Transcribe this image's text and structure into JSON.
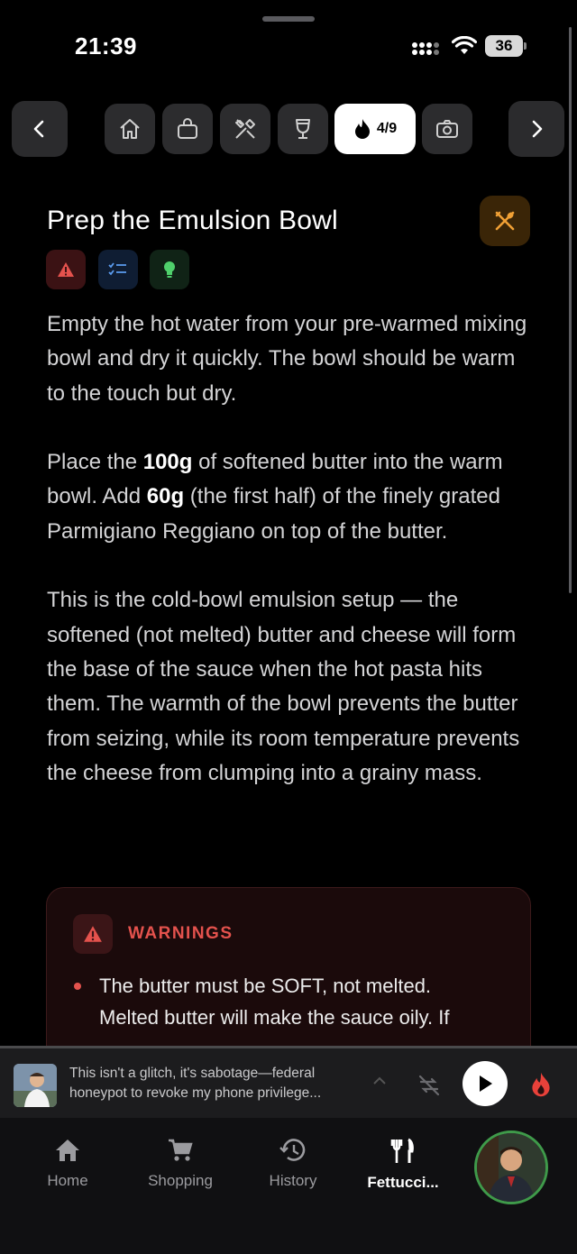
{
  "status_bar": {
    "time": "21:39",
    "battery": "36"
  },
  "step_nav": {
    "prev_icon": "chevron-left-icon",
    "next_icon": "chevron-right-icon",
    "chips": [
      {
        "icon": "home-icon"
      },
      {
        "icon": "shopping-bag-icon"
      },
      {
        "icon": "tools-icon"
      },
      {
        "icon": "cocktail-glass-icon"
      },
      {
        "icon": "flame-icon",
        "label": "4/9",
        "active": true
      },
      {
        "icon": "camera-icon"
      }
    ]
  },
  "step": {
    "title": "Prep the Emulsion Bowl",
    "badges": [
      "warning-icon",
      "checklist-icon",
      "lightbulb-icon"
    ],
    "paragraphs": {
      "p1": "Empty the hot water from your pre-warmed mixing bowl and dry it quickly. The bowl should be warm to the touch but dry.",
      "p2_a": "Place the ",
      "p2_b1": "100g",
      "p2_c": " of softened butter into the warm bowl. Add ",
      "p2_b2": "60g",
      "p2_d": " (the first half) of the finely grated Parmigiano Reggiano on top of the butter.",
      "p3": "This is the cold-bowl emulsion setup — the softened (not melted) butter and cheese will form the base of the sauce when the hot pasta hits them. The warmth of the bowl prevents the butter from seizing, while its room temperature prevents the cheese from clumping into a grainy mass."
    },
    "warnings": {
      "label": "WARNINGS",
      "items": [
        "The butter must be SOFT, not melted. Melted butter will make the sauce oily. If"
      ]
    }
  },
  "now_playing": {
    "text": "This isn't a glitch, it's sabotage—federal honeypot to revoke my phone privilege..."
  },
  "tabs": [
    {
      "label": "Home",
      "icon": "home-icon"
    },
    {
      "label": "Shopping",
      "icon": "cart-icon"
    },
    {
      "label": "History",
      "icon": "history-icon"
    },
    {
      "label": "Fettucci...",
      "icon": "utensils-icon",
      "active": true
    }
  ],
  "colors": {
    "accent_warning": "#e4524d",
    "accent_tool": "#f0a035",
    "active_ring": "#3f9a4a"
  }
}
